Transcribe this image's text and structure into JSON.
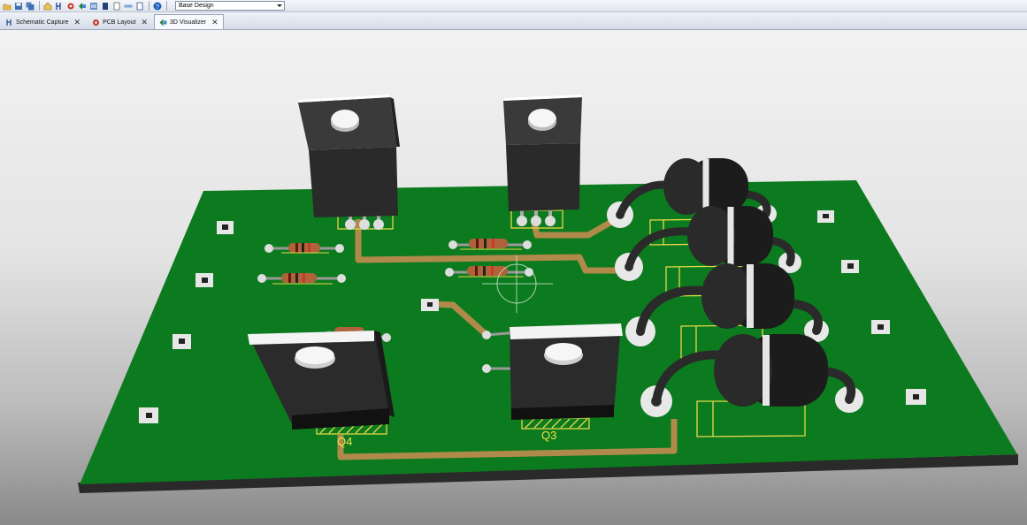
{
  "toolbar": {
    "icons": [
      "open-icon",
      "save-icon",
      "save-all-icon",
      "home-icon",
      "netlist-icon",
      "gear-icon",
      "back-icon",
      "bom-icon",
      "document-icon",
      "report-icon",
      "ruler-icon",
      "print-icon",
      "help-icon"
    ],
    "design_select": "Base Design"
  },
  "tabs": [
    {
      "label": "Schematic Capture",
      "icon": "schematic-icon",
      "active": false
    },
    {
      "label": "PCB Layout",
      "icon": "pcb-icon",
      "active": false
    },
    {
      "label": "3D Visualizer",
      "icon": "3d-icon",
      "active": true
    }
  ],
  "board": {
    "labels": {
      "q3": "Q3",
      "q4": "Q4"
    },
    "colors": {
      "board": "#0c7a1e",
      "copper": "#b08a4a",
      "silkscreen": "#f2e24a",
      "background": "#e8e8e8"
    }
  }
}
